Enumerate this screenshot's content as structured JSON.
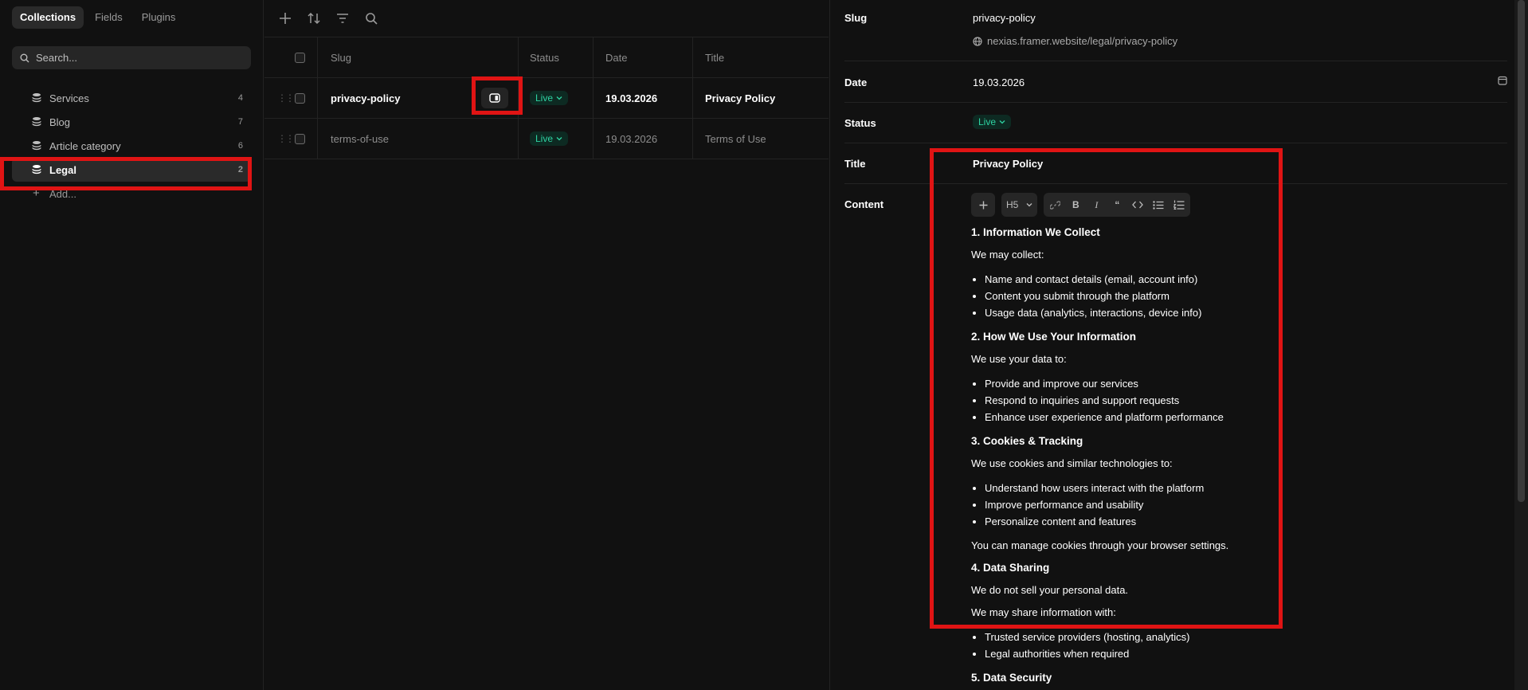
{
  "sidebar": {
    "tabs": [
      {
        "label": "Collections",
        "active": true
      },
      {
        "label": "Fields"
      },
      {
        "label": "Plugins"
      }
    ],
    "search_placeholder": "Search...",
    "collections": [
      {
        "label": "Services",
        "count": "4"
      },
      {
        "label": "Blog",
        "count": "7"
      },
      {
        "label": "Article category",
        "count": "6"
      },
      {
        "label": "Legal",
        "count": "2",
        "active": true
      }
    ],
    "add_label": "Add..."
  },
  "table": {
    "toolbar_icons": [
      "plus-icon",
      "sort-icon",
      "filter-icon",
      "search-icon"
    ],
    "headers": {
      "slug": "Slug",
      "status": "Status",
      "date": "Date",
      "title": "Title"
    },
    "rows": [
      {
        "slug": "privacy-policy",
        "status": "Live",
        "date": "19.03.2026",
        "title": "Privacy Policy",
        "selected": true
      },
      {
        "slug": "terms-of-use",
        "status": "Live",
        "date": "19.03.2026",
        "title": "Terms of Use"
      }
    ]
  },
  "detail": {
    "slug_label": "Slug",
    "slug_value": "privacy-policy",
    "url": "nexias.framer.website/legal/privacy-policy",
    "date_label": "Date",
    "date_value": "19.03.2026",
    "status_label": "Status",
    "status_value": "Live",
    "title_label": "Title",
    "title_value": "Privacy Policy",
    "content_label": "Content",
    "toolbar": {
      "heading": "H5"
    },
    "content": {
      "h1": "1. Information We Collect",
      "p1": "We may collect:",
      "list1": [
        "Name and contact details (email, account info)",
        "Content you submit through the platform",
        "Usage data (analytics, interactions, device info)"
      ],
      "h2": "2. How We Use Your Information",
      "p2": "We use your data to:",
      "list2": [
        "Provide and improve our services",
        "Respond to inquiries and support requests",
        "Enhance user experience and platform performance"
      ],
      "h3": "3. Cookies & Tracking",
      "p3": "We use cookies and similar technologies to:",
      "list3": [
        "Understand how users interact with the platform",
        "Improve performance and usability",
        "Personalize content and features"
      ],
      "p4": "You can manage cookies through your browser settings.",
      "h4": "4. Data Sharing",
      "p5": "We do not sell your personal data.",
      "p6": "We may share information with:",
      "list4": [
        "Trusted service providers (hosting, analytics)",
        "Legal authorities when required"
      ],
      "h5": "5. Data Security"
    }
  },
  "colors": {
    "accent_live": "#2ed3a2",
    "highlight": "#e01414",
    "background": "#111111"
  }
}
